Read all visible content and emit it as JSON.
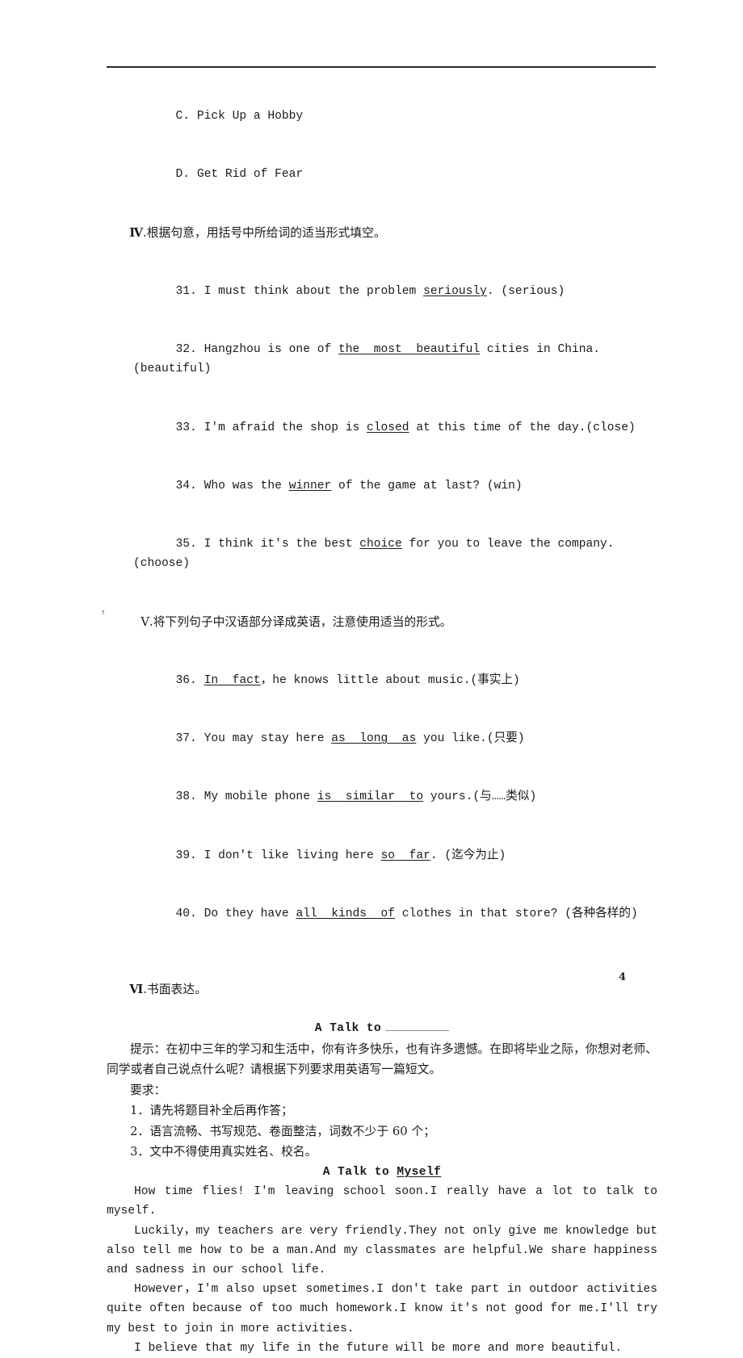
{
  "page": {
    "number": "4",
    "header_rule": true
  },
  "carryover_options": [
    {
      "label": "C. Pick Up a Hobby"
    },
    {
      "label": "D. Get Rid of Fear"
    }
  ],
  "section_iv": {
    "numeral": "Ⅳ",
    "heading": ".根据句意，用括号中所给词的适当形式填空。",
    "items": [
      {
        "number": "31.",
        "pre": " I must think about the problem ",
        "answer": "seriously",
        "post": ". (serious)"
      },
      {
        "number": "32.",
        "pre": " Hangzhou is one of ",
        "answer": "the  most  beautiful",
        "post": " cities in China.(beautiful)"
      },
      {
        "number": "33.",
        "pre": " I'm afraid the shop is ",
        "answer": "closed",
        "post": " at this time of the day.(close)"
      },
      {
        "number": "34.",
        "pre": " Who was the ",
        "answer": "winner",
        "post": " of the game at last? (win)"
      },
      {
        "number": "35.",
        "pre": " I think it's the best ",
        "answer": "choice",
        "post": " for you to leave the company.(choose)"
      }
    ]
  },
  "section_v": {
    "numeral": "Ⅴ",
    "heading": ".将下列句子中汉语部分译成英语，注意使用适当的形式。",
    "items": [
      {
        "number": "36.",
        "pre": " ",
        "answer": "In  fact",
        "post": "，he knows little about music.(事实上)"
      },
      {
        "number": "37.",
        "pre": " You may stay here ",
        "answer": "as  long  as",
        "post": " you like.(只要)"
      },
      {
        "number": "38.",
        "pre": " My mobile phone ",
        "answer": "is  similar  to",
        "post": " yours.(与……类似)"
      },
      {
        "number": "39.",
        "pre": " I don't like living here ",
        "answer": "so  far",
        "post": ". (迄今为止)"
      },
      {
        "number": "40.",
        "pre": " Do they have ",
        "answer": "all  kinds  of",
        "post": " clothes in that store? (各种各样的)"
      }
    ]
  },
  "section_vi": {
    "numeral": "Ⅵ",
    "heading": ".书面表达。",
    "prompt_title_prefix": "A Talk to",
    "hint": "提示：在初中三年的学习和生活中，你有许多快乐，也有许多遗憾。在即将毕业之际，你想对老师、同学或者自己说点什么呢？请根据下列要求用英语写一篇短文。",
    "requirements_label": "要求：",
    "requirements": [
      "1．请先将题目补全后再作答；",
      "2．语言流畅、书写规范、卷面整洁，词数不少于 60 个；",
      "3．文中不得使用真实姓名、校名。"
    ],
    "essay_title_prefix": "A Talk to ",
    "essay_title_blank": "Myself",
    "essay_paragraphs": [
      "How time flies! I'm leaving school soon.I really have a lot to talk to myself.",
      "Luckily，my teachers are very friendly.They not only give me knowledge but also tell me how to be a man.And my classmates are helpful.We share happiness and sadness in our school life.",
      "However，I'm also upset sometimes.I don't take part in outdoor activities quite often because of too much homework.I know it's not good for me.I'll try my best to join in more activities.",
      "I believe that my life in the future will be more and more beautiful."
    ]
  },
  "artifacts": {
    "stray_comma": "，"
  }
}
